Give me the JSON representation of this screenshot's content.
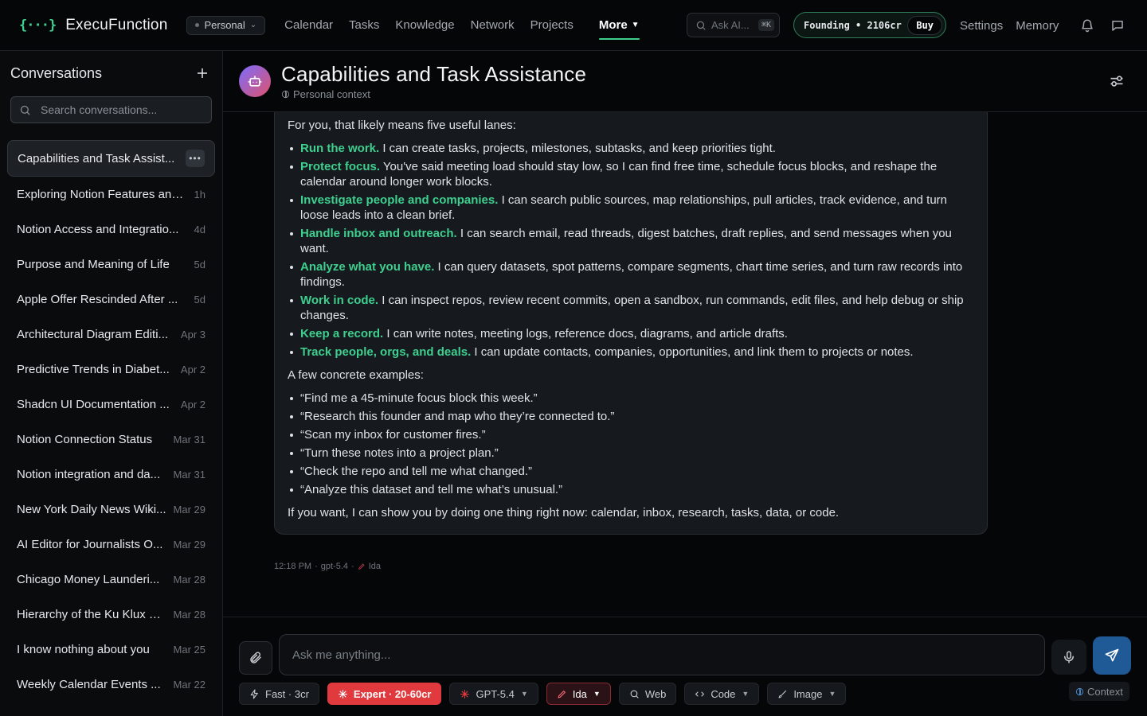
{
  "app": {
    "logo_mark": "{···}",
    "name": "ExecuFunction"
  },
  "header": {
    "context_selector": "Personal",
    "nav": [
      "Calendar",
      "Tasks",
      "Knowledge",
      "Network",
      "Projects"
    ],
    "more_label": "More",
    "ask_placeholder": "Ask AI...",
    "ask_shortcut": "⌘K",
    "plan_badge": "Founding • 2106cr",
    "buy_label": "Buy",
    "settings_label": "Settings",
    "memory_label": "Memory",
    "accent_color": "#3ecf8e"
  },
  "sidebar": {
    "title": "Conversations",
    "search_placeholder": "Search conversations...",
    "conversations": [
      {
        "title": "Capabilities and Task Assist...",
        "date": "",
        "active": true
      },
      {
        "title": "Exploring Notion Features and...",
        "date": "1h"
      },
      {
        "title": "Notion Access and Integratio...",
        "date": "4d"
      },
      {
        "title": "Purpose and Meaning of Life",
        "date": "5d"
      },
      {
        "title": "Apple Offer Rescinded After ...",
        "date": "5d"
      },
      {
        "title": "Architectural Diagram Editi...",
        "date": "Apr 3"
      },
      {
        "title": "Predictive Trends in Diabet...",
        "date": "Apr 2"
      },
      {
        "title": "Shadcn UI Documentation ...",
        "date": "Apr 2"
      },
      {
        "title": "Notion Connection Status",
        "date": "Mar 31"
      },
      {
        "title": "Notion integration and da...",
        "date": "Mar 31"
      },
      {
        "title": "New York Daily News Wiki...",
        "date": "Mar 29"
      },
      {
        "title": "AI Editor for Journalists O...",
        "date": "Mar 29"
      },
      {
        "title": "Chicago Money Launderi...",
        "date": "Mar 28"
      },
      {
        "title": "Hierarchy of the Ku Klux Kl...",
        "date": "Mar 28"
      },
      {
        "title": "I know nothing about you",
        "date": "Mar 25"
      },
      {
        "title": "Weekly Calendar Events ...",
        "date": "Mar 22"
      }
    ]
  },
  "chat": {
    "title": "Capabilities and Task Assistance",
    "subtitle": "Personal context",
    "message": {
      "intro": "For you, that likely means five useful lanes:",
      "lanes": [
        {
          "name": "Run the work.",
          "text": " I can create tasks, projects, milestones, subtasks, and keep priorities tight."
        },
        {
          "name": "Protect focus.",
          "text": " You've said meeting load should stay low, so I can find free time, schedule focus blocks, and reshape the calendar around longer work blocks."
        },
        {
          "name": "Investigate people and companies.",
          "text": " I can search public sources, map relationships, pull articles, track evidence, and turn loose leads into a clean brief."
        },
        {
          "name": "Handle inbox and outreach.",
          "text": " I can search email, read threads, digest batches, draft replies, and send messages when you want."
        },
        {
          "name": "Analyze what you have.",
          "text": " I can query datasets, spot patterns, compare segments, chart time series, and turn raw records into findings."
        },
        {
          "name": "Work in code.",
          "text": " I can inspect repos, review recent commits, open a sandbox, run commands, edit files, and help debug or ship changes."
        },
        {
          "name": "Keep a record.",
          "text": " I can write notes, meeting logs, reference docs, diagrams, and article drafts."
        },
        {
          "name": "Track people, orgs, and deals.",
          "text": " I can update contacts, companies, opportunities, and link them to projects or notes."
        }
      ],
      "examples_intro": "A few concrete examples:",
      "examples": [
        "“Find me a 45-minute focus block this week.”",
        "“Research this founder and map who they’re connected to.”",
        "“Scan my inbox for customer fires.”",
        "“Turn these notes into a project plan.”",
        "“Check the repo and tell me what changed.”",
        "“Analyze this dataset and tell me what’s unusual.”"
      ],
      "closing": "If you want, I can show you by doing one thing right now: calendar, inbox, research, tasks, data, or code."
    },
    "meta": {
      "time": "12:18 PM",
      "model": "gpt-5.4",
      "persona": "Ida"
    }
  },
  "composer": {
    "placeholder": "Ask me anything...",
    "tools": {
      "fast": "Fast · 3cr",
      "expert": "Expert · 20-60cr",
      "model": "GPT-5.4",
      "persona": "Ida",
      "web": "Web",
      "code": "Code",
      "image": "Image"
    },
    "context_label": "Context"
  }
}
